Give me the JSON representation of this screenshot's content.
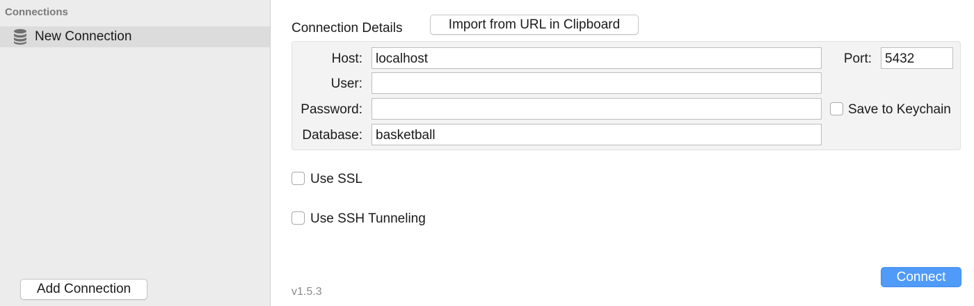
{
  "sidebar": {
    "header": "Connections",
    "items": [
      {
        "label": "New Connection",
        "icon": "database-icon",
        "selected": true
      }
    ],
    "add_button": "Add Connection"
  },
  "main": {
    "section_title": "Connection Details",
    "import_button": "Import from URL in Clipboard",
    "fields": {
      "host": {
        "label": "Host:",
        "value": "localhost"
      },
      "port": {
        "label": "Port:",
        "value": "5432"
      },
      "user": {
        "label": "User:",
        "value": ""
      },
      "password": {
        "label": "Password:",
        "value": ""
      },
      "database": {
        "label": "Database:",
        "value": "basketball"
      }
    },
    "save_keychain": {
      "label": "Save to Keychain",
      "checked": false
    },
    "use_ssl": {
      "label": "Use SSL",
      "checked": false
    },
    "use_ssh": {
      "label": "Use SSH Tunneling",
      "checked": false
    },
    "version": "v1.5.3",
    "connect_button": "Connect"
  },
  "colors": {
    "sidebar_bg": "#ececec",
    "selected_item_bg": "#dcdcdc",
    "accent": "#4f9bf7"
  }
}
